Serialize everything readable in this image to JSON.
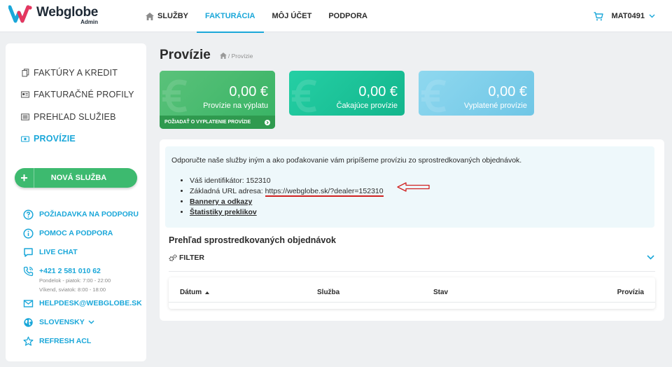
{
  "brand": {
    "name": "Webglobe",
    "sub": "Admin"
  },
  "nav": {
    "items": [
      {
        "label": "SLUŽBY"
      },
      {
        "label": "FAKTURÁCIA"
      },
      {
        "label": "MÔJ ÚČET"
      },
      {
        "label": "PODPORA"
      }
    ],
    "user": "MAT0491"
  },
  "sidebar": {
    "menu": [
      {
        "label": "FAKTÚRY A KREDIT"
      },
      {
        "label": "FAKTURAČNÉ PROFILY"
      },
      {
        "label": "PREHĽAD SLUŽIEB"
      },
      {
        "label": "PROVÍZIE"
      }
    ],
    "new_service": "NOVÁ SLUŽBA",
    "support": {
      "ticket": "POŽIADAVKA NA PODPORU",
      "help": "POMOC A PODPORA",
      "chat": "LIVE CHAT",
      "phone": "+421 2 581 010 62",
      "hours_week": "Pondelok - piatok: 7:00 - 22:00",
      "hours_weekend": "Víkend, sviatok: 8:00 - 18:00",
      "email": "HELPDESK@WEBGLOBE.SK",
      "language": "SLOVENSKY",
      "refresh": "REFRESH ACL"
    }
  },
  "page": {
    "title": "Provízie",
    "breadcrumb": "/ Provízie"
  },
  "cards": [
    {
      "amount": "0,00 €",
      "label": "Provízie na výplatu",
      "action": "POŽIADAŤ O VYPLATENIE PROVÍZIE"
    },
    {
      "amount": "0,00 €",
      "label": "Čakajúce provízie"
    },
    {
      "amount": "0,00 €",
      "label": "Vyplatené provízie"
    }
  ],
  "info": {
    "intro": "Odporučte naše služby iným a ako poďakovanie vám pripíšeme províziu zo sprostredkovaných objednávok.",
    "id_label": "Váš identifikátor: 152310",
    "url_label": "Základná URL adresa:",
    "url": "https://webglobe.sk/?dealer=152310",
    "banners": "Bannery a odkazy",
    "stats": "Štatistiky preklikov"
  },
  "orders": {
    "title": "Prehľad sprostredkovaných objednávok",
    "filter": "FILTER",
    "columns": [
      {
        "label": "Dátum"
      },
      {
        "label": "Služba"
      },
      {
        "label": "Stav"
      },
      {
        "label": "Provízia"
      }
    ]
  },
  "colors": {
    "accent": "#1aa7d9",
    "green": "#3dba6f",
    "teal": "#13b68d",
    "light_blue": "#7fcfea"
  }
}
